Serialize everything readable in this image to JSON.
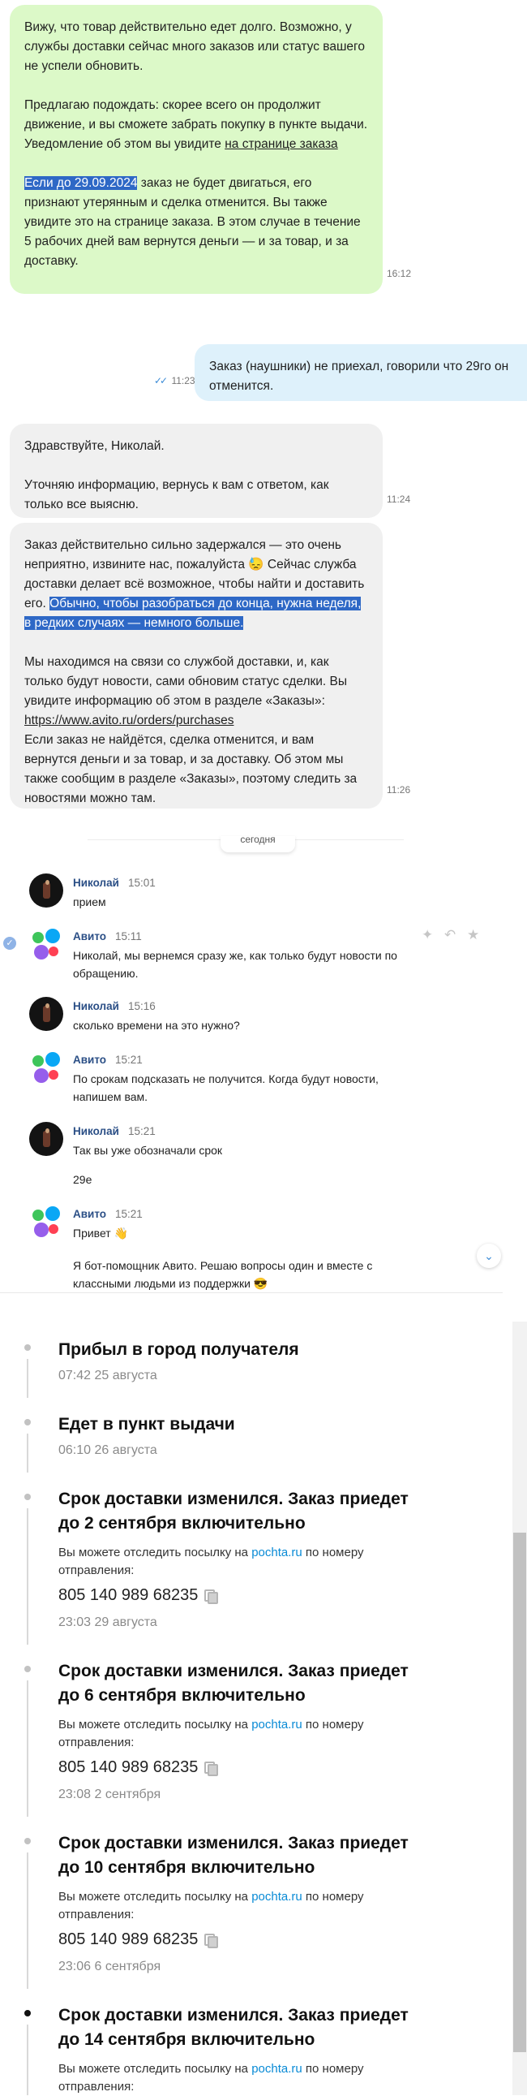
{
  "chat1": {
    "bubble1": {
      "p1": "Вижу, что товар действительно едет долго. Возможно, у службы доставки сейчас много заказов или статус вашего не успели обновить.",
      "p2_before_link": "Предлагаю подождать: скорее всего он продолжит движение, и вы сможете забрать покупку в пункте выдачи. Уведомление об этом вы увидите ",
      "p2_link": "на странице заказа",
      "p3_highlight": "Если до 29.09.2024",
      "p3_rest": " заказ не будет двигаться, его признают утерянным и сделка отменится. Вы также увидите это на странице заказа. В этом случае в течение 5 рабочих дней вам вернутся деньги — и за товар, и за доставку.",
      "time": "16:12"
    },
    "user_message": {
      "text": "Заказ (наушники) не приехал, говорили что 29го он отменится.",
      "time": "11:23",
      "read_marks": "✓✓"
    },
    "bubble2": {
      "p1": "Здравствуйте, Николай.",
      "p2": "Уточняю информацию, вернусь к вам с ответом, как только все выясню.",
      "time": "11:24"
    },
    "bubble3": {
      "p1_start": "Заказ действительно сильно задержался — это очень неприятно, извините нас, пожалуйста 😓 Сейчас служба доставки делает всё возможное, чтобы найти и доставить его. ",
      "p1_highlight": "Обычно, чтобы разобраться до конца, нужна неделя, в редких случаях — немного больше.",
      "p2_start": "Мы находимся на связи со службой доставки, и, как только будут новости, сами обновим статус сделки. Вы увидите информацию об этом в разделе «Заказы»: ",
      "p2_link": "https://www.avito.ru/orders/purchases",
      "p2_end": "Если заказ не найдётся, сделка отменится, и вам вернутся деньги и за товар, и за доставку. Об этом мы также сообщим в разделе «Заказы», поэтому следить за новостями можно там.",
      "time": "11:26"
    }
  },
  "chat2": {
    "date_chip": "сегодня",
    "messages": [
      {
        "name": "Николай",
        "time": "15:01",
        "text": "прием"
      },
      {
        "name": "Авито",
        "time": "15:11",
        "text": "Николай, мы вернемся сразу же, как только будут новости по обращению."
      },
      {
        "name": "Николай",
        "time": "15:16",
        "text": "сколько времени на это нужно?"
      },
      {
        "name": "Авито",
        "time": "15:21",
        "text": "По срокам подсказать не получится. Когда будут новости, напишем вам."
      },
      {
        "name": "Николай",
        "time": "15:21",
        "text": "Так вы уже обозначали срок",
        "text2": "29е"
      },
      {
        "name": "Авито",
        "time": "15:21",
        "text": "Привет 👋",
        "text2": "Я бот-помощник Авито. Решаю вопросы один и вместе с классными людьми из поддержки 😎"
      }
    ],
    "icons": [
      "sparkle-icon",
      "reply-icon",
      "star-icon",
      "scroll-down-icon"
    ]
  },
  "tracking": {
    "events": [
      {
        "title": "Прибыл в город получателя",
        "date": "07:42 25 августа"
      },
      {
        "title": "Едет в пункт выдачи",
        "date": "06:10 26 августа"
      },
      {
        "title": "Срок доставки изменился. Заказ приедет до 2 сентября включительно",
        "desc_before": "Вы можете отследить посылку на ",
        "desc_link": "pochta.ru",
        "desc_after": " по номеру отправления:",
        "track": "805 140 989 68235",
        "date": "23:03 29 августа"
      },
      {
        "title": "Срок доставки изменился. Заказ приедет до 6 сентября включительно",
        "desc_before": "Вы можете отследить посылку на ",
        "desc_link": "pochta.ru",
        "desc_after": " по номеру отправления:",
        "track": "805 140 989 68235",
        "date": "23:08 2 сентября"
      },
      {
        "title": "Срок доставки изменился. Заказ приедет до 10 сентября включительно",
        "desc_before": "Вы можете отследить посылку на ",
        "desc_link": "pochta.ru",
        "desc_after": " по номеру отправления:",
        "track": "805 140 989 68235",
        "date": "23:06 6 сентября"
      },
      {
        "title": "Срок доставки изменился. Заказ приедет до 14 сентября включительно",
        "desc_before": "Вы можете отследить посылку на ",
        "desc_link": "pochta.ru",
        "desc_after": " по номеру отправления:"
      }
    ]
  },
  "colors": {
    "green_bubble": "#dcf9c8",
    "blue_bubble": "#def1fb",
    "highlight": "#2e68c6",
    "name": "#2b4f86",
    "link": "#0a8bd6"
  }
}
